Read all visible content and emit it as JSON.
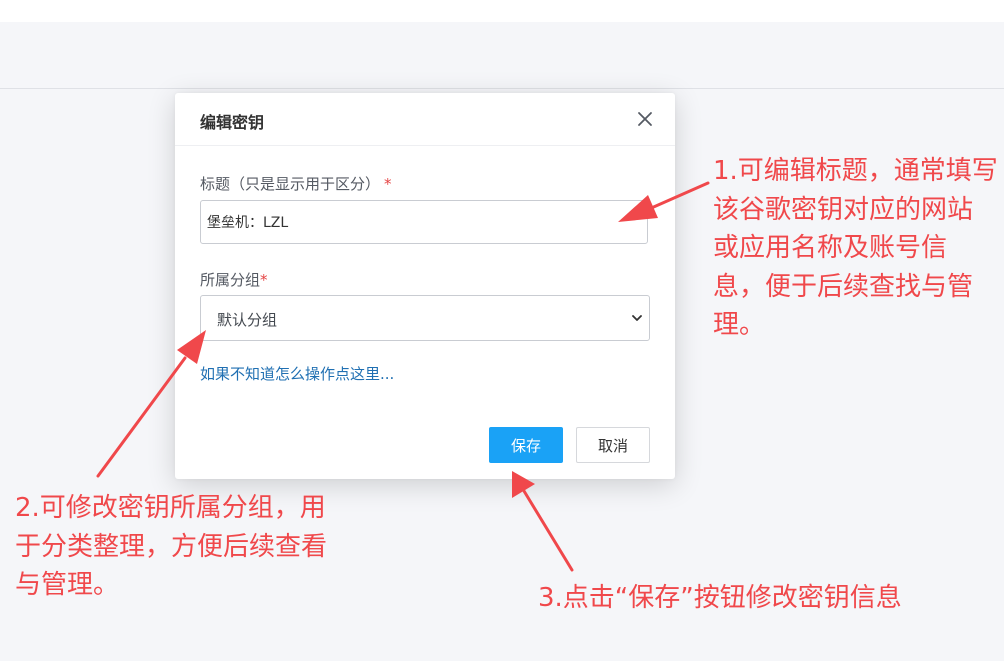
{
  "dialog": {
    "title": "编辑密钥",
    "title_field": {
      "label": "标题（只是显示用于区分）",
      "required_mark": "*",
      "value": "堡垒机：LZL"
    },
    "group_field": {
      "label": "所属分组",
      "required_mark": "*",
      "selected": "默认分组"
    },
    "help_link": "如果不知道怎么操作点这里...",
    "save_label": "保存",
    "cancel_label": "取消"
  },
  "annotations": {
    "note1": "1.可编辑标题，通常填写该谷歌密钥对应的网站或应用名称及账号信息，便于后续查找与管理。",
    "note2": "2.可修改密钥所属分组，用于分类整理，方便后续查看与管理。",
    "note3": "3.点击“保存”按钮修改密钥信息"
  },
  "colors": {
    "annotation": "#f0484b",
    "primary_button": "#1aa2f6",
    "link": "#1f6fb2",
    "required": "#e54545"
  },
  "icons": {
    "close": "close-icon",
    "dropdown": "chevron-down-icon"
  }
}
